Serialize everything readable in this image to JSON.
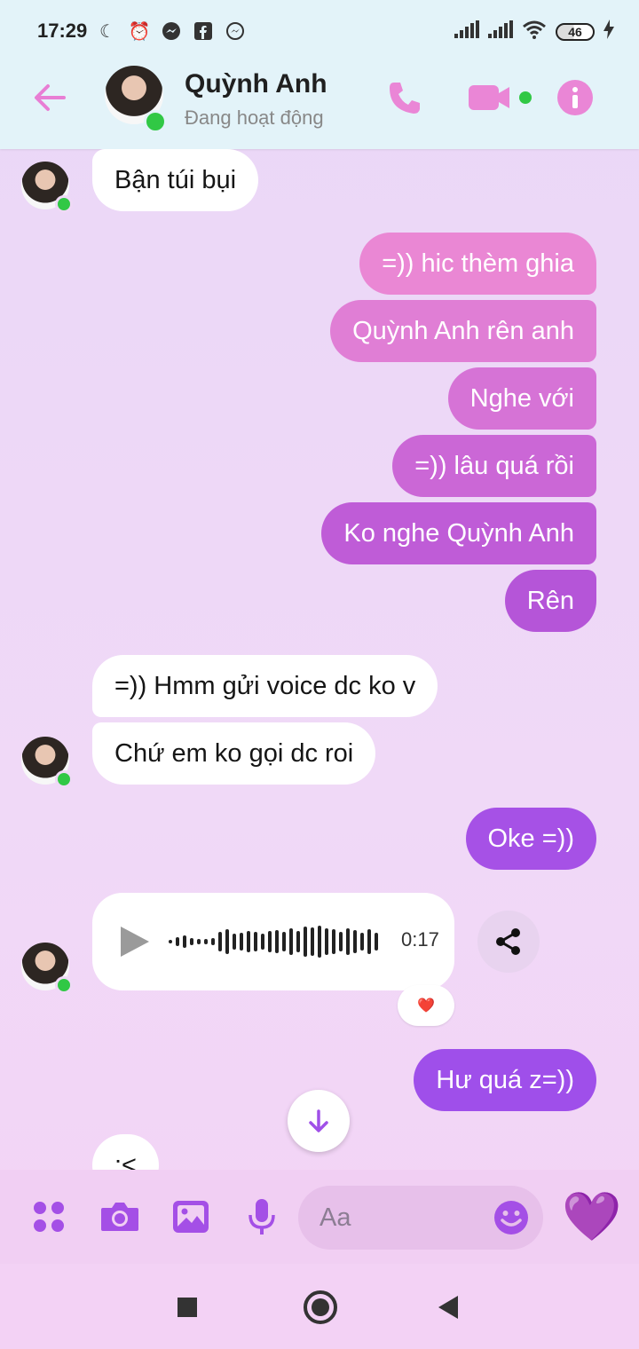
{
  "status_bar": {
    "time": "17:29",
    "battery": "46"
  },
  "header": {
    "name": "Quỳnh Anh",
    "status": "Đang hoạt động",
    "icons": [
      "back-arrow-icon",
      "phone-icon",
      "video-camera-icon",
      "info-icon"
    ]
  },
  "messages": {
    "m1": "Bận túi bụi",
    "m2": "=)) hic thèm ghia",
    "m3": "Quỳnh Anh rên anh",
    "m4": "Nghe với",
    "m5": "=)) lâu quá rồi",
    "m6": "Ko nghe Quỳnh Anh",
    "m7": "Rên",
    "m8": "=)) Hmm gửi voice dc ko v",
    "m9": "Chứ em ko gọi dc roi",
    "m10": "Oke =))",
    "voice_duration": "0:17",
    "voice_reaction": "❤️",
    "m11": "Hư quá z=))",
    "m12": ":<"
  },
  "composer": {
    "placeholder": "Aa",
    "like": "💜"
  },
  "colors": {
    "accent": "#a855f7",
    "header_bg": "#e3f3f9",
    "chat_bg": "#ecd8f7",
    "bubble_out_top": "#e985d6",
    "bubble_out_bottom": "#9f4fea",
    "online": "#31c845"
  }
}
